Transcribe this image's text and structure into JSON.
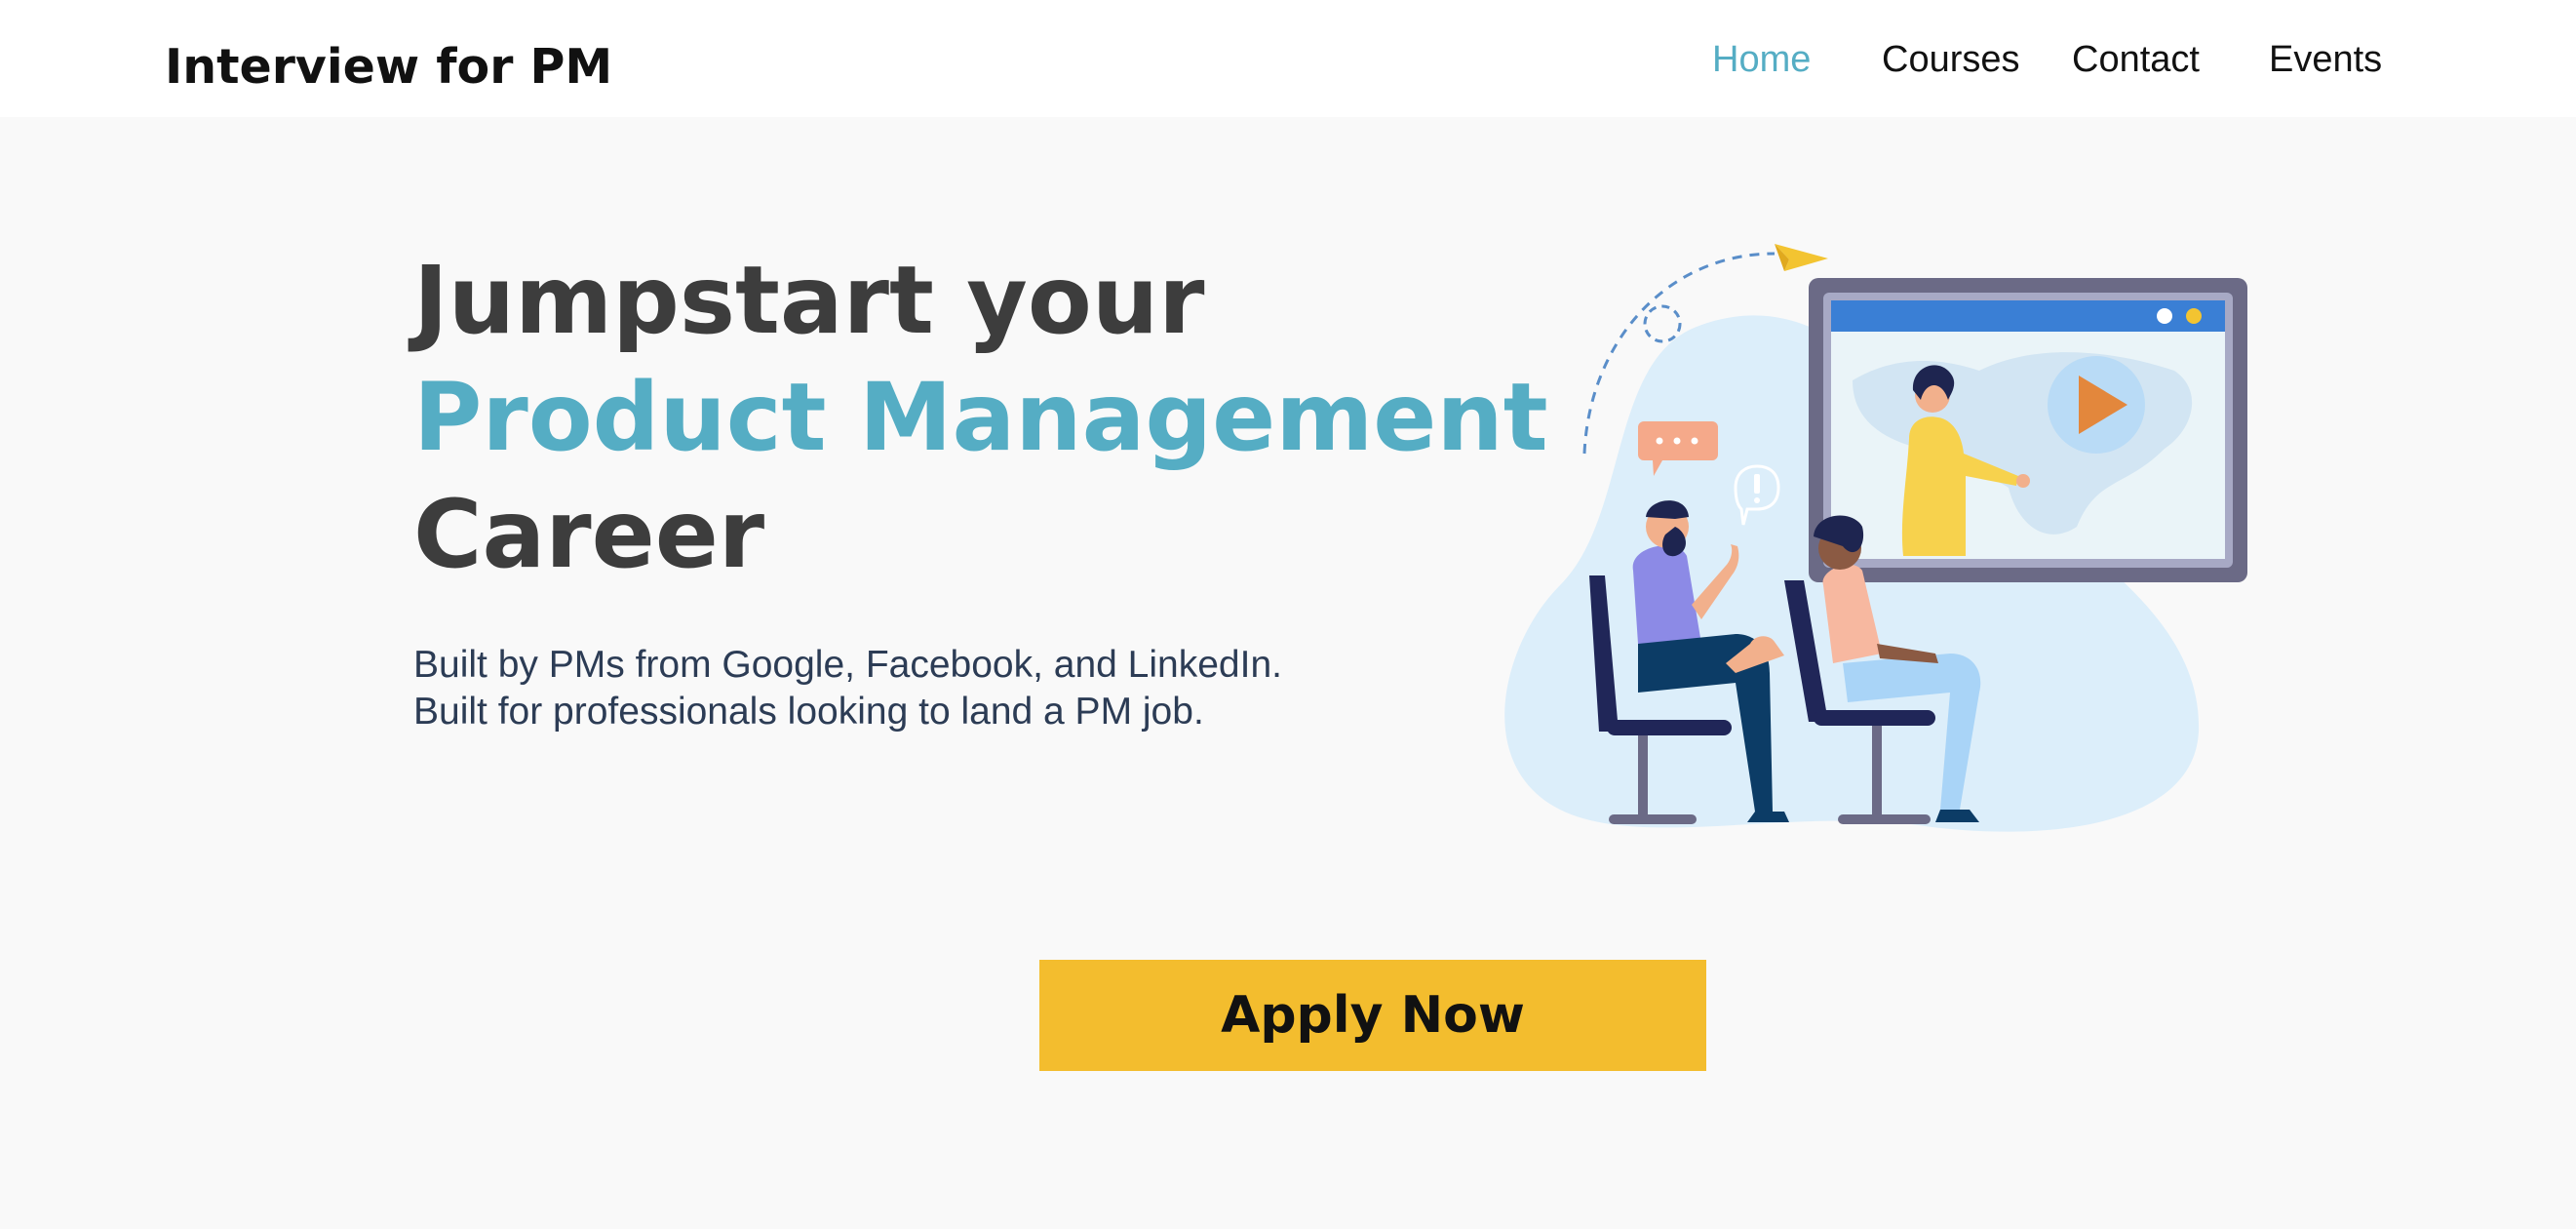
{
  "header": {
    "brand": "Interview for PM",
    "nav": [
      {
        "label": "Home",
        "active": true
      },
      {
        "label": "Courses",
        "active": false
      },
      {
        "label": "Contact",
        "active": false
      },
      {
        "label": "Events",
        "active": false
      }
    ]
  },
  "hero": {
    "title_line1": "Jumpstart your",
    "title_line2": "Product Management",
    "title_line3": "Career",
    "subtitle_line1": "Built by PMs from Google, Facebook, and LinkedIn.",
    "subtitle_line2": "Built for professionals looking to land a PM job.",
    "cta_label": "Apply Now",
    "illustration_icon": "online-classroom-illustration"
  },
  "colors": {
    "accent": "#55adc4",
    "cta": "#f3bd2e",
    "heading": "#3d3d3d",
    "body_text": "#2c3c55",
    "background": "#f9f9f9"
  }
}
